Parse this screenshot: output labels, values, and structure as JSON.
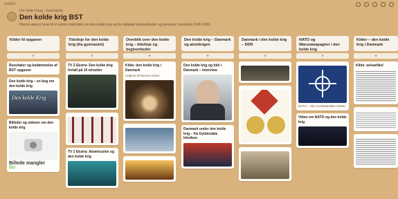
{
  "brand": "padlet",
  "board": {
    "owner": "Der Kalte Krieg · Geschichte",
    "title": "Den kolde krig BST",
    "description": "Denne væg er lavet til at samle materialer om den kolde krig og de vigtigste begivenheder og personer i perioden 1945-1991."
  },
  "columns": [
    {
      "title": "Kilder til opgaven",
      "cards": [
        {
          "title": "Resultater og bedømmelse af BST opgaven",
          "text": ""
        },
        {
          "title": "Den kolde krig – en bog om den kolde krig",
          "text": "",
          "thumb_caption": "Den kolde Krig"
        },
        {
          "title": "Billeder og videoer om den kolde krig",
          "text": "",
          "missing_label": "Billede mangler",
          "gu_label": "GU"
        }
      ]
    },
    {
      "title": "Tidslinje for den kolde krig (fra gymnasiet)",
      "cards": [
        {
          "title": "TV 2 Ekstra: Den kolde krig fortalt på 10 minutter",
          "text": ""
        },
        {
          "title": "",
          "text": ""
        },
        {
          "title": "TV 2 Ekstra: Atomtruslen og den kolde krig",
          "text": ""
        }
      ]
    },
    {
      "title": "Overblik over den kolde krig – tidslinje og begivenheder",
      "cards": [
        {
          "title": "Kilde: den kolde krig i Danmark",
          "text": "Udgivet af historie-online"
        },
        {
          "title": "",
          "text": ""
        },
        {
          "title": "",
          "text": ""
        }
      ]
    },
    {
      "title": "Den kolde krig – Danmark og atomkrigen",
      "cards": [
        {
          "title": "Den kolde krig og folk i Danmark – interview",
          "text": ""
        },
        {
          "title": "Danmark under den kolde krig – fra Gyldendals leksikon",
          "text": ""
        }
      ]
    },
    {
      "title": "Danmark i den kolde krig – DDR",
      "cards": [
        {
          "title": "",
          "text": ""
        },
        {
          "title": "",
          "text": ""
        },
        {
          "title": "",
          "text": ""
        }
      ]
    },
    {
      "title": "NATO og Warszawapagten i den kolde krig",
      "cards": [
        {
          "title": "",
          "text": "NATO – den nordatlantiske traktat"
        },
        {
          "title": "Video om NATO og den kolde krig",
          "text": ""
        }
      ]
    },
    {
      "title": "Kilder – den kolde krig i Danmark",
      "cards": [
        {
          "title": "Kilde: avisartikel",
          "text": ""
        },
        {
          "title": "",
          "text": ""
        },
        {
          "title": "",
          "text": ""
        }
      ]
    }
  ],
  "colors": {
    "background": "#d9b27e",
    "card": "#fffdf9",
    "header": "#f7f2ea"
  }
}
